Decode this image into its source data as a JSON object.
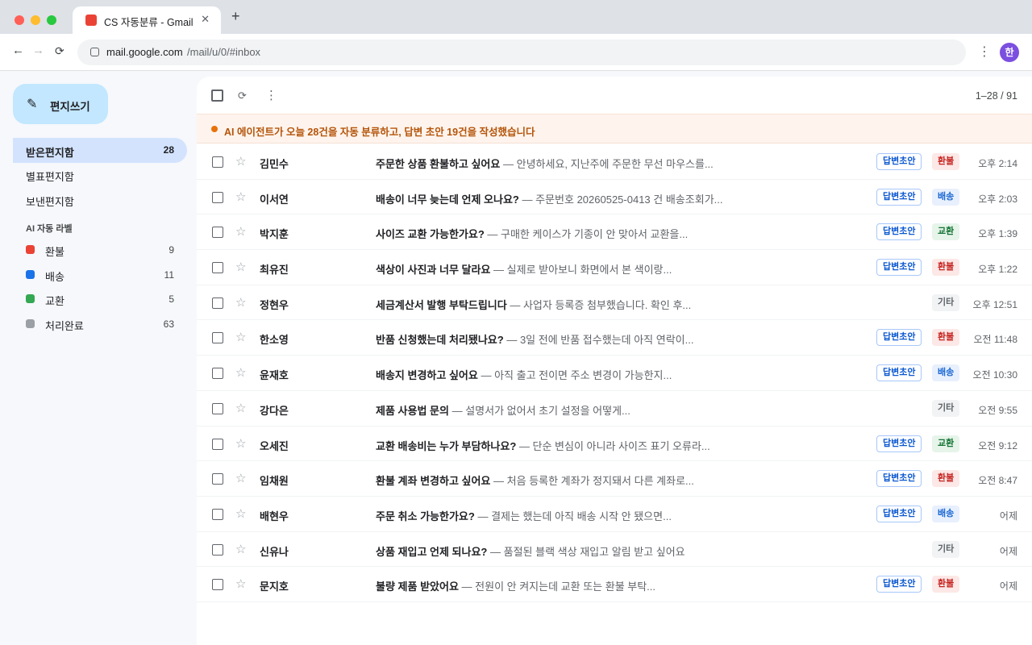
{
  "browser": {
    "tab_title": "CS 자동분류 - Gmail",
    "tab_close": "✕",
    "new_tab": "+",
    "url_host": "mail.google.com",
    "url_path": "/mail/u/0/#inbox",
    "avatar_letter": "한"
  },
  "compose": {
    "label": "편지쓰기",
    "icon": "pencil-icon"
  },
  "folders": [
    {
      "label": "받은편지함",
      "count": "28",
      "active": true
    },
    {
      "label": "별표편지함",
      "count": ""
    },
    {
      "label": "보낸편지함",
      "count": ""
    }
  ],
  "labels_section": {
    "title": "AI 자동 라벨",
    "items": [
      {
        "name": "환불",
        "count": "9",
        "color": "#ea4335"
      },
      {
        "name": "배송",
        "count": "11",
        "color": "#1a73e8"
      },
      {
        "name": "교환",
        "count": "5",
        "color": "#34a853"
      },
      {
        "name": "처리완료",
        "count": "63",
        "color": "#9aa0a6"
      }
    ]
  },
  "toolbar": {
    "pagination": "1–28 / 91"
  },
  "banner": {
    "text": "AI 에이전트가 오늘 28건을 자동 분류하고, 답변 초안 19건을 작성했습니다"
  },
  "colors": {
    "accent": "#0b57d0",
    "banner_text": "#b4540a",
    "banner_bg": "#fff4ed"
  },
  "emails": [
    {
      "sender": "김민수",
      "subject": "주문한 상품 환불하고 싶어요",
      "snippet": "안녕하세요, 지난주에 주문한 무선 마우스를...",
      "draft": "답변초안",
      "category": "환불",
      "cat_key": "refund",
      "time": "오후 2:14"
    },
    {
      "sender": "이서연",
      "subject": "배송이 너무 늦는데 언제 오나요?",
      "snippet": "주문번호 20260525-0413 건 배송조회가...",
      "draft": "답변초안",
      "category": "배송",
      "cat_key": "shipping",
      "time": "오후 2:03"
    },
    {
      "sender": "박지훈",
      "subject": "사이즈 교환 가능한가요?",
      "snippet": "구매한 케이스가 기종이 안 맞아서 교환을...",
      "draft": "답변초안",
      "category": "교환",
      "cat_key": "exchange",
      "time": "오후 1:39"
    },
    {
      "sender": "최유진",
      "subject": "색상이 사진과 너무 달라요",
      "snippet": "실제로 받아보니 화면에서 본 색이랑...",
      "draft": "답변초안",
      "category": "환불",
      "cat_key": "refund",
      "time": "오후 1:22"
    },
    {
      "sender": "정현우",
      "subject": "세금계산서 발행 부탁드립니다",
      "snippet": "사업자 등록증 첨부했습니다. 확인 후...",
      "draft": "",
      "category": "기타",
      "cat_key": "other",
      "time": "오후 12:51"
    },
    {
      "sender": "한소영",
      "subject": "반품 신청했는데 처리됐나요?",
      "snippet": "3일 전에 반품 접수했는데 아직 연락이...",
      "draft": "답변초안",
      "category": "환불",
      "cat_key": "refund",
      "time": "오전 11:48"
    },
    {
      "sender": "윤재호",
      "subject": "배송지 변경하고 싶어요",
      "snippet": "아직 출고 전이면 주소 변경이 가능한지...",
      "draft": "답변초안",
      "category": "배송",
      "cat_key": "shipping",
      "time": "오전 10:30"
    },
    {
      "sender": "강다은",
      "subject": "제품 사용법 문의",
      "snippet": "설명서가 없어서 초기 설정을 어떻게...",
      "draft": "",
      "category": "기타",
      "cat_key": "other",
      "time": "오전 9:55"
    },
    {
      "sender": "오세진",
      "subject": "교환 배송비는 누가 부담하나요?",
      "snippet": "단순 변심이 아니라 사이즈 표기 오류라...",
      "draft": "답변초안",
      "category": "교환",
      "cat_key": "exchange",
      "time": "오전 9:12"
    },
    {
      "sender": "임채원",
      "subject": "환불 계좌 변경하고 싶어요",
      "snippet": "처음 등록한 계좌가 정지돼서 다른 계좌로...",
      "draft": "답변초안",
      "category": "환불",
      "cat_key": "refund",
      "time": "오전 8:47"
    },
    {
      "sender": "배현우",
      "subject": "주문 취소 가능한가요?",
      "snippet": "결제는 했는데 아직 배송 시작 안 됐으면...",
      "draft": "답변초안",
      "category": "배송",
      "cat_key": "shipping",
      "time": "어제"
    },
    {
      "sender": "신유나",
      "subject": "상품 재입고 언제 되나요?",
      "snippet": "품절된 블랙 색상 재입고 알림 받고 싶어요",
      "draft": "",
      "category": "기타",
      "cat_key": "other",
      "time": "어제"
    },
    {
      "sender": "문지호",
      "subject": "불량 제품 받았어요",
      "snippet": "전원이 안 켜지는데 교환 또는 환불 부탁...",
      "draft": "답변초안",
      "category": "환불",
      "cat_key": "refund",
      "time": "어제"
    }
  ],
  "separator": "—"
}
